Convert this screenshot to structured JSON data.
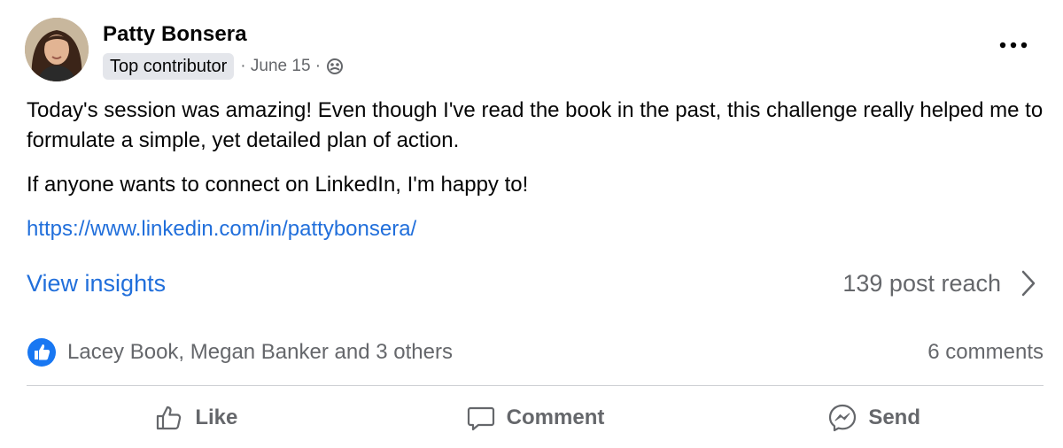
{
  "post": {
    "author": {
      "name": "Patty Bonsera",
      "badge": "Top contributor",
      "date": "· June 15 ·",
      "audience_icon": "group-icon"
    },
    "more_icon": "more-options-icon",
    "body": {
      "paragraph_1": "Today's session was amazing! Even though I've read the book in the past, this challenge really helped me to formulate a simple, yet detailed plan of action.",
      "paragraph_2": "If anyone wants to connect on LinkedIn, I'm happy to!",
      "link": "https://www.linkedin.com/in/pattybonsera/"
    },
    "insights": {
      "label": "View insights",
      "reach": "139 post reach"
    },
    "reactions": {
      "icon": "like-reaction-icon",
      "summary": "Lacey Book, Megan Banker and 3 others",
      "comments": "6 comments"
    },
    "actions": [
      {
        "label": "Like",
        "icon": "thumbs-up-icon"
      },
      {
        "label": "Comment",
        "icon": "comment-icon"
      },
      {
        "label": "Send",
        "icon": "messenger-icon"
      }
    ]
  },
  "colors": {
    "link_blue": "#216fdb",
    "secondary_text": "#65676b",
    "primary_text": "#050505",
    "badge_bg": "#e4e6eb",
    "divider": "#ced0d4",
    "like_blue": "#1877f2"
  }
}
